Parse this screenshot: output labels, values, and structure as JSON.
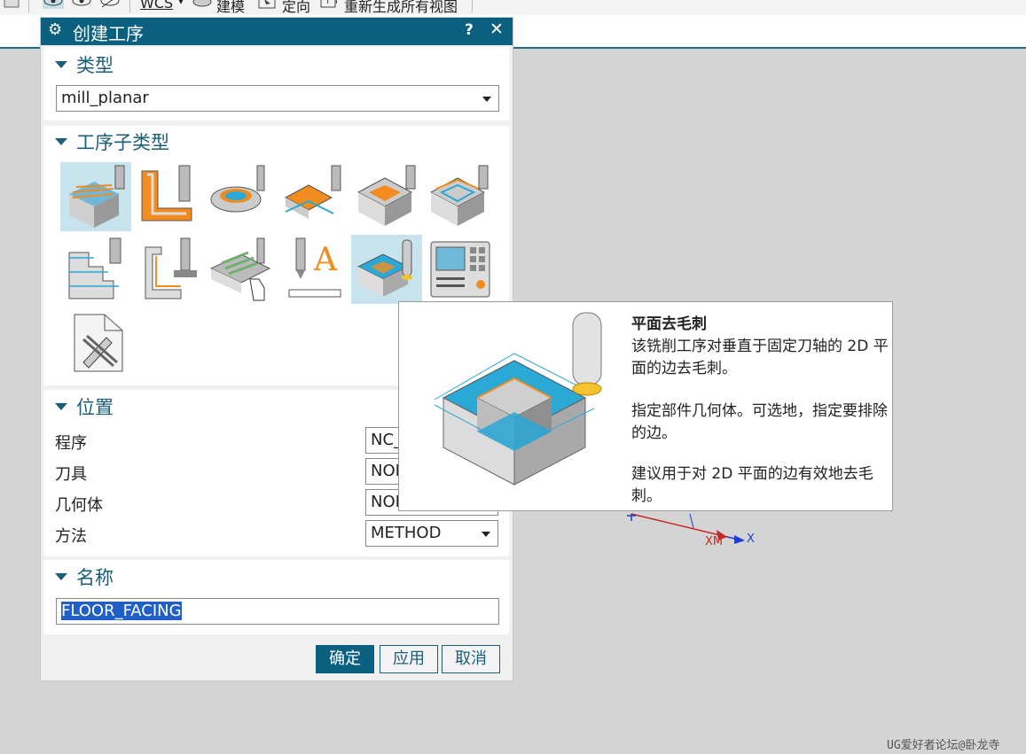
{
  "toolbar": {
    "wcs": "WCS",
    "model": "建模",
    "orient": "定向",
    "regen": "重新生成所有视图"
  },
  "dialog": {
    "title": "创建工序",
    "help": "?",
    "close": "✕",
    "type_section": {
      "header": "类型",
      "value": "mill_planar"
    },
    "subtype_section": {
      "header": "工序子类型",
      "subtypes": [
        {
          "name": "floor-wall",
          "selected": true
        },
        {
          "name": "floor-wall-is",
          "selected": false
        },
        {
          "name": "face-milling",
          "selected": false
        },
        {
          "name": "face-milling-area",
          "selected": false
        },
        {
          "name": "cavity-mill-planar",
          "selected": false
        },
        {
          "name": "rough-planar",
          "selected": false
        },
        {
          "name": "planar-profile",
          "selected": false
        },
        {
          "name": "cleanup-corners",
          "selected": false
        },
        {
          "name": "manual-face",
          "selected": false
        },
        {
          "name": "planar-text",
          "selected": false
        },
        {
          "name": "planar-deburr",
          "selected": true
        },
        {
          "name": "mill-control",
          "selected": false
        },
        {
          "name": "mill-user",
          "selected": false
        }
      ]
    },
    "location_section": {
      "header": "位置",
      "fields": [
        {
          "label": "程序",
          "value": "NC_PROGRAM"
        },
        {
          "label": "刀具",
          "value": "NONE"
        },
        {
          "label": "几何体",
          "value": "NONE"
        },
        {
          "label": "方法",
          "value": "METHOD"
        }
      ]
    },
    "name_section": {
      "header": "名称",
      "value": "FLOOR_FACING"
    },
    "buttons": {
      "ok": "确定",
      "apply": "应用",
      "cancel": "取消"
    }
  },
  "tooltip": {
    "title": "平面去毛刺",
    "line1": "该铣削工序对垂直于固定刀轴的 2D 平面的边去毛刺。",
    "line2": "指定部件几何体。可选地，指定要排除的边。",
    "line3": "建议用于对 2D 平面的边有效地去毛刺。"
  },
  "viewport": {
    "xm_label": "XM",
    "x_label": "X"
  },
  "watermark": "UG爱好者论坛@卧龙寺",
  "colors": {
    "title_bar": "#0b5f7f",
    "accent": "#1a5e78",
    "selected_tile": "#c7e3ee",
    "part_orange": "#f28c1e",
    "part_cyan": "#2aa8d6"
  }
}
